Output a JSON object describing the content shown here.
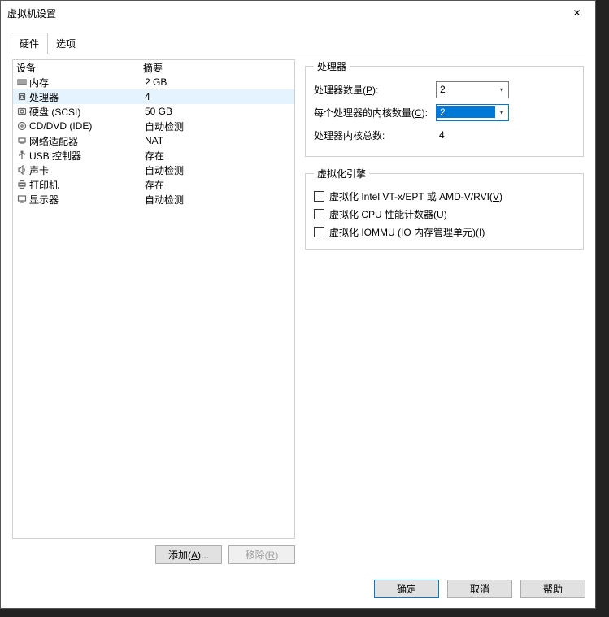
{
  "window": {
    "title": "虚拟机设置",
    "close": "✕"
  },
  "tabs": [
    {
      "label": "硬件",
      "active": true
    },
    {
      "label": "选项",
      "active": false
    }
  ],
  "device_list": {
    "header_device": "设备",
    "header_summary": "摘要",
    "rows": [
      {
        "icon": "memory",
        "device": "内存",
        "summary": "2 GB"
      },
      {
        "icon": "cpu",
        "device": "处理器",
        "summary": "4",
        "selected": true
      },
      {
        "icon": "disk",
        "device": "硬盘 (SCSI)",
        "summary": "50 GB"
      },
      {
        "icon": "cd",
        "device": "CD/DVD (IDE)",
        "summary": "自动检测"
      },
      {
        "icon": "net",
        "device": "网络适配器",
        "summary": "NAT"
      },
      {
        "icon": "usb",
        "device": "USB 控制器",
        "summary": "存在"
      },
      {
        "icon": "sound",
        "device": "声卡",
        "summary": "自动检测"
      },
      {
        "icon": "printer",
        "device": "打印机",
        "summary": "存在"
      },
      {
        "icon": "display",
        "device": "显示器",
        "summary": "自动检测"
      }
    ]
  },
  "left_buttons": {
    "add": "添加(A)...",
    "remove": "移除(R)"
  },
  "right_pane": {
    "processor_group": "处理器",
    "proc_count_label_pre": "处理器数量(",
    "proc_count_key": "P",
    "proc_count_label_post": "):",
    "proc_count_value": "2",
    "cores_label_pre": "每个处理器的内核数量(",
    "cores_key": "C",
    "cores_label_post": "):",
    "cores_value": "2",
    "total_label": "处理器内核总数:",
    "total_value": "4",
    "virt_group": "虚拟化引擎",
    "virt_vt_pre": "虚拟化 Intel VT-x/EPT 或 AMD-V/RVI(",
    "virt_vt_key": "V",
    "virt_vt_post": ")",
    "virt_cnt_pre": "虚拟化 CPU 性能计数器(",
    "virt_cnt_key": "U",
    "virt_cnt_post": ")",
    "virt_iommu_pre": "虚拟化 IOMMU (IO 内存管理单元)(",
    "virt_iommu_key": "I",
    "virt_iommu_post": ")"
  },
  "footer": {
    "ok": "确定",
    "cancel": "取消",
    "help": "帮助"
  }
}
